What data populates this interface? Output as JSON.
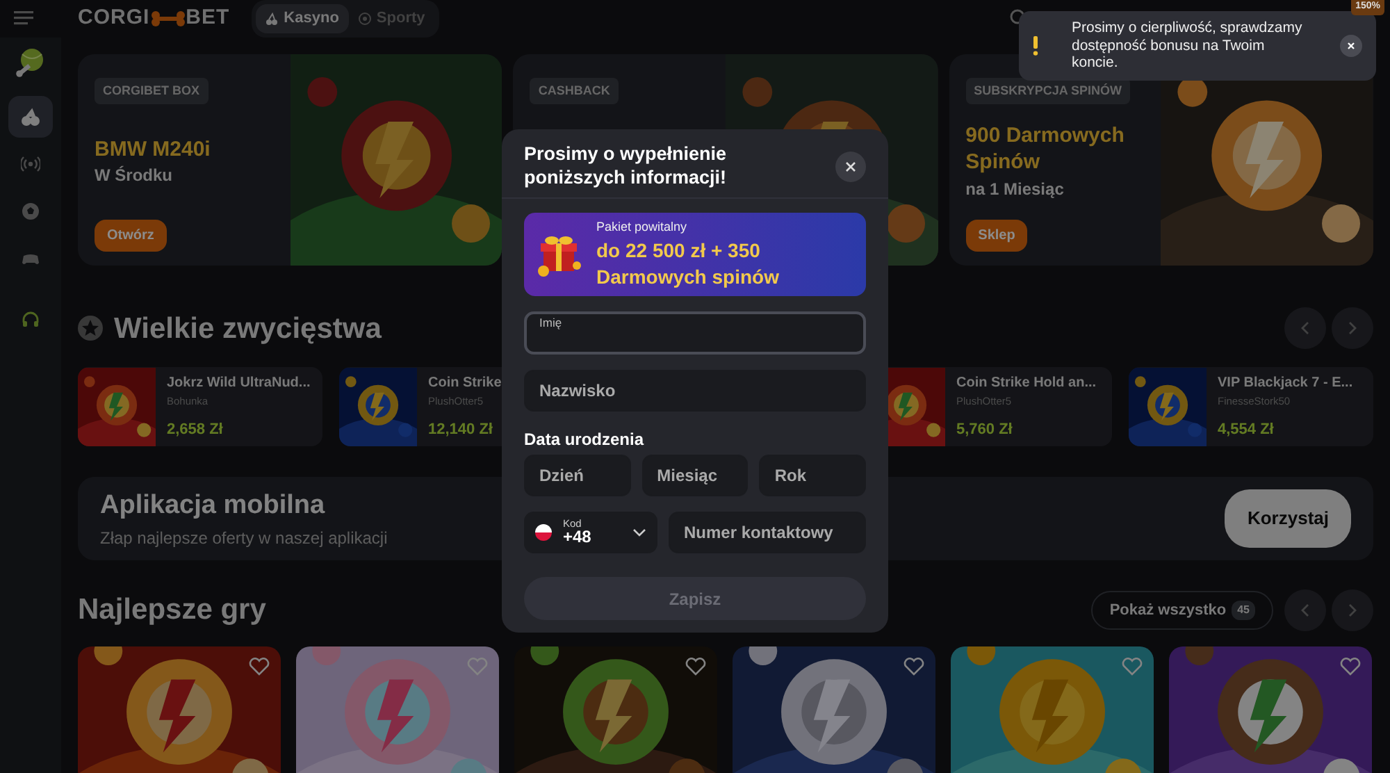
{
  "header": {
    "logo": {
      "left": "CORGI",
      "right": "BET"
    },
    "mode_tabs": [
      {
        "label": "Kasyno",
        "selected": true
      },
      {
        "label": "Sporty",
        "selected": false
      }
    ],
    "bonus_badge": "150%"
  },
  "sidebar": {
    "items": [
      {
        "selected": true
      },
      {
        "selected": false
      },
      {
        "selected": false
      },
      {
        "selected": false
      },
      {
        "selected": false
      }
    ]
  },
  "banners": [
    {
      "tag": "CORGIBET BOX",
      "title": "BMW M240i",
      "subtitle": "W Środku",
      "button": "Otwórz"
    },
    {
      "tag": "CASHBACK"
    },
    {
      "tag": "SUBSKRYPCJA SPINÓW",
      "title": "900 Darmowych Spinów",
      "subtitle": "na 1 Miesiąc",
      "button": "Sklep"
    }
  ],
  "big_wins": {
    "title": "Wielkie zwycięstwa",
    "items": [
      {
        "game": "Jokrz Wild UltraNud...",
        "player": "Bohunka",
        "amount": "2,658 Zł"
      },
      {
        "game": "Coin Strike",
        "player": "PlushOtter5",
        "amount": "12,140 Zł"
      },
      {
        "game": "Coin Strike Hold an...",
        "player": "PlushOtter5",
        "amount": "5,760 Zł"
      },
      {
        "game": "VIP Blackjack 7 - E...",
        "player": "FinesseStork50",
        "amount": "4,554 Zł"
      }
    ]
  },
  "app_promo": {
    "title": "Aplikacja mobilna",
    "subtitle": "Złap najlepsze oferty w naszej aplikacji",
    "button": "Korzystaj"
  },
  "top_games": {
    "title": "Najlepsze gry",
    "show_all": "Pokaż wszystko",
    "count": "45"
  },
  "modal": {
    "title": "Prosimy o wypełnienie poniższych informacji!",
    "promo": {
      "label": "Pakiet powitalny",
      "headline": "do 22 500 zł + 350 Darmowych spinów"
    },
    "name_fields": [
      {
        "label": "Imię",
        "focused": true
      },
      {
        "placeholder": "Nazwisko",
        "focused": false
      }
    ],
    "birth_date": {
      "label": "Data urodzenia",
      "fields": [
        {
          "placeholder": "Dzień"
        },
        {
          "placeholder": "Miesiąc"
        },
        {
          "placeholder": "Rok"
        }
      ]
    },
    "phone": {
      "code_label": "Kod",
      "code": "+48",
      "placeholder": "Numer kontaktowy"
    },
    "submit": {
      "label": "Zapisz",
      "disabled": true
    }
  },
  "toast": {
    "message": "Prosimy o cierpliwość, sprawdzamy dostępność bonusu na Twoim koncie."
  }
}
